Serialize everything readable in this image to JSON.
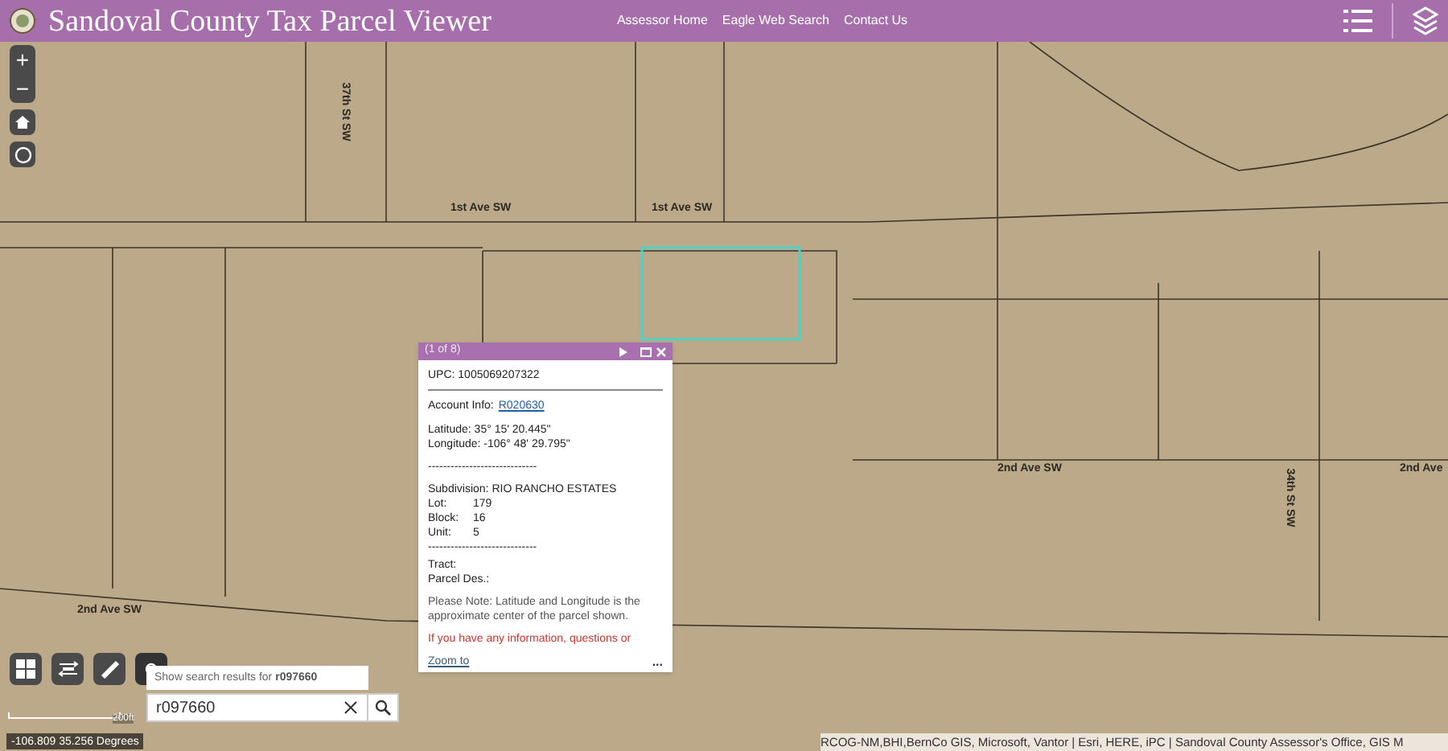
{
  "header": {
    "title": "Sandoval County Tax Parcel Viewer",
    "links": [
      "Assessor Home",
      "Eagle Web Search",
      "Contact Us"
    ]
  },
  "map": {
    "street_labels": [
      {
        "text": "1st Ave SW",
        "kind": "horizontal"
      },
      {
        "text": "1st Ave SW",
        "kind": "horizontal"
      },
      {
        "text": "2nd Ave SW",
        "kind": "horizontal"
      },
      {
        "text": "2nd Ave",
        "kind": "horizontal"
      },
      {
        "text": "2nd Ave SW",
        "kind": "horizontal"
      },
      {
        "text": "37th St SW",
        "kind": "vertical"
      },
      {
        "text": "34th St SW",
        "kind": "vertical"
      }
    ],
    "scale": "200ft",
    "coordinates": "-106.809 35.256 Degrees",
    "attribution": "RCOG-NM,BHI,BernCo GIS, Microsoft, Vantor | Esri, HERE, iPC | Sandoval County Assessor's Office, GIS M"
  },
  "zoom_controls": [
    "+",
    "−"
  ],
  "popup": {
    "title": "(1 of 8)",
    "upc": "UPC: 1005069207322",
    "account_label": "Account Info:",
    "account_link": "R020630",
    "latitude": "Latitude: 35° 15' 20.445\"",
    "longitude": "Longitude: -106° 48' 29.795\"",
    "separator_1": "-----------------------------",
    "subdivision": "Subdivision: RIO RANCHO ESTATES",
    "rows": [
      {
        "label": "Lot:",
        "value": "179"
      },
      {
        "label": "Block:",
        "value": "16"
      },
      {
        "label": "Unit:",
        "value": "5"
      }
    ],
    "separator_2": "-----------------------------",
    "tract": "Tract:",
    "parcel_des": "Parcel Des.:",
    "note": "Please Note: Latitude and Longitude is the approximate center of the parcel shown.",
    "warning": "If you have any information, questions or",
    "zoom_link": "Zoom to",
    "more": "..."
  },
  "search": {
    "suggestion_prefix": "Show search results for ",
    "suggestion_term": "r097660",
    "value": "r097660"
  }
}
